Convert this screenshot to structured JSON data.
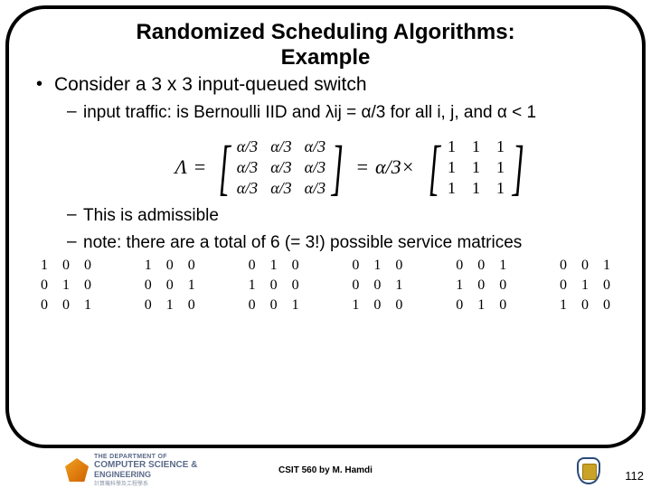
{
  "title_line1": "Randomized Scheduling Algorithms:",
  "title_line2": "Example",
  "bullet_main": "Consider a 3 x 3 input-queued switch",
  "sub1": "input traffic: is Bernoulli IID and λij =  α/3 for all i, j, and α < 1",
  "sub2": "This is admissible",
  "sub3": "note: there are a total of 6 (= 3!) possible service matrices",
  "eq": {
    "lambda_sym": "Λ",
    "equals": "=",
    "cell": "α/3",
    "mult": "α/3×",
    "one": "1"
  },
  "perm_matrices": [
    [
      "1",
      "0",
      "0",
      "0",
      "1",
      "0",
      "0",
      "0",
      "1"
    ],
    [
      "1",
      "0",
      "0",
      "0",
      "0",
      "1",
      "0",
      "1",
      "0"
    ],
    [
      "0",
      "1",
      "0",
      "1",
      "0",
      "0",
      "0",
      "0",
      "1"
    ],
    [
      "0",
      "1",
      "0",
      "0",
      "0",
      "1",
      "1",
      "0",
      "0"
    ],
    [
      "0",
      "0",
      "1",
      "1",
      "0",
      "0",
      "0",
      "1",
      "0"
    ],
    [
      "0",
      "0",
      "1",
      "0",
      "1",
      "0",
      "1",
      "0",
      "0"
    ]
  ],
  "footer": {
    "dept_the": "THE DEPARTMENT OF",
    "dept_cs": "COMPUTER SCIENCE &",
    "dept_eng": "ENGINEERING",
    "dept_cn": "計算機科學及工程學系",
    "center": "CSIT 560 by M. Hamdi",
    "page": "112"
  }
}
